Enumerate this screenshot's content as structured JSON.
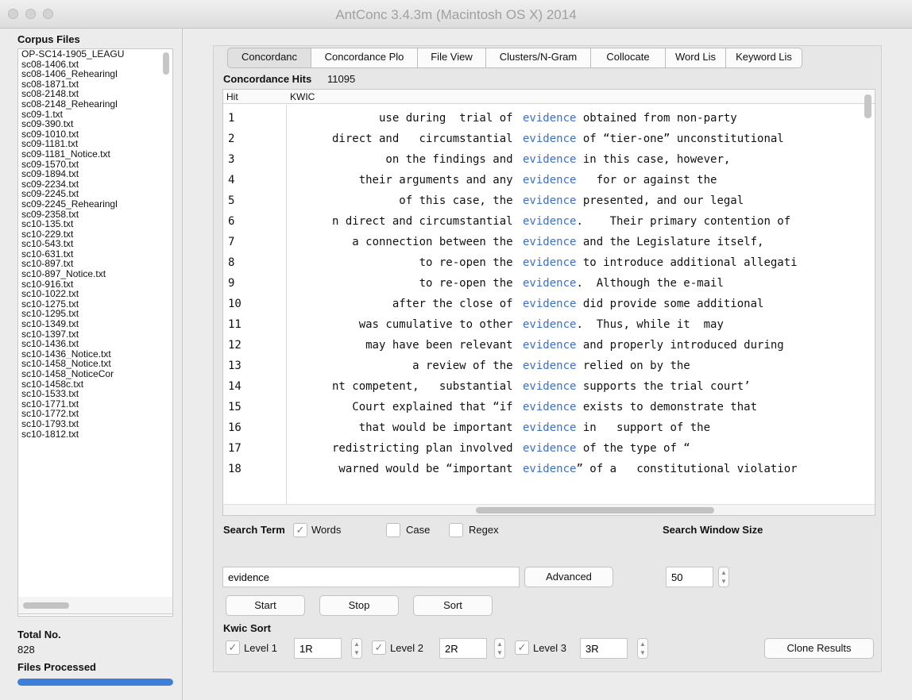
{
  "window": {
    "title": "AntConc 3.4.3m (Macintosh OS X) 2014"
  },
  "corpus": {
    "title": "Corpus Files",
    "files": [
      "OP-SC14-1905_LEAGU",
      "sc08-1406.txt",
      "sc08-1406_Rehearingl",
      "sc08-1871.txt",
      "sc08-2148.txt",
      "sc08-2148_Rehearingl",
      "sc09-1.txt",
      "sc09-390.txt",
      "sc09-1010.txt",
      "sc09-1181.txt",
      "sc09-1181_Notice.txt",
      "sc09-1570.txt",
      "sc09-1894.txt",
      "sc09-2234.txt",
      "sc09-2245.txt",
      "sc09-2245_Rehearingl",
      "sc09-2358.txt",
      "sc10-135.txt",
      "sc10-229.txt",
      "sc10-543.txt",
      "sc10-631.txt",
      "sc10-897.txt",
      "sc10-897_Notice.txt",
      "sc10-916.txt",
      "sc10-1022.txt",
      "sc10-1275.txt",
      "sc10-1295.txt",
      "sc10-1349.txt",
      "sc10-1397.txt",
      "sc10-1436.txt",
      "sc10-1436_Notice.txt",
      "sc10-1458_Notice.txt",
      "sc10-1458_NoticeCor",
      "sc10-1458c.txt",
      "sc10-1533.txt",
      "sc10-1771.txt",
      "sc10-1772.txt",
      "sc10-1793.txt",
      "sc10-1812.txt"
    ],
    "total_label": "Total No.",
    "total_value": "828",
    "processed_label": "Files Processed",
    "processed_fraction": 1.0
  },
  "tabs": [
    {
      "label": "Concordanc",
      "active": true
    },
    {
      "label": "Concordance Plo",
      "active": false
    },
    {
      "label": "File View",
      "active": false
    },
    {
      "label": "Clusters/N-Gram",
      "active": false
    },
    {
      "label": "Collocate",
      "active": false
    },
    {
      "label": "Word Lis",
      "active": false
    },
    {
      "label": "Keyword Lis",
      "active": false
    }
  ],
  "concordance": {
    "hits_label": "Concordance Hits",
    "hits_value": "11095",
    "col_hit": "Hit",
    "col_kwic": "KWIC",
    "keyword": "evidence",
    "rows": [
      {
        "n": "1",
        "left": "use during  trial of ",
        "after": " obtained from non-party"
      },
      {
        "n": "2",
        "left": "direct and   circumstantial ",
        "after": " of “tier-one” unconstitutional"
      },
      {
        "n": "3",
        "left": "on the findings and ",
        "after": " in this case, however,"
      },
      {
        "n": "4",
        "left": "their arguments and any ",
        "after": "   for or against the"
      },
      {
        "n": "5",
        "left": "of this case, the ",
        "after": " presented, and our legal"
      },
      {
        "n": "6",
        "left": "n direct and circumstantial ",
        "after": ".    Their primary contention of"
      },
      {
        "n": "7",
        "left": "a connection between the ",
        "after": " and the Legislature itself,"
      },
      {
        "n": "8",
        "left": "to re-open the ",
        "after": " to introduce additional allegati"
      },
      {
        "n": "9",
        "left": "to re-open the ",
        "after": ".  Although the e-mail"
      },
      {
        "n": "10",
        "left": "after the close of ",
        "after": " did provide some additional"
      },
      {
        "n": "11",
        "left": "was cumulative to other ",
        "after": ".  Thus, while it  may"
      },
      {
        "n": "12",
        "left": "may have been relevant ",
        "after": " and properly introduced during"
      },
      {
        "n": "13",
        "left": "a review of the ",
        "after": " relied on by the"
      },
      {
        "n": "14",
        "left": "nt competent,   substantial ",
        "after": " supports the trial court’"
      },
      {
        "n": "15",
        "left": "Court explained that “if ",
        "after": " exists to demonstrate that"
      },
      {
        "n": "16",
        "left": "that would be important ",
        "after": " in   support of the"
      },
      {
        "n": "17",
        "left": "redistricting plan involved ",
        "after": " of the type of “"
      },
      {
        "n": "18",
        "left": "warned would be “important ",
        "after": "” of a   constitutional violatior"
      }
    ]
  },
  "search": {
    "term_label": "Search Term",
    "words_label": "Words",
    "words_checked": true,
    "case_label": "Case",
    "case_checked": false,
    "regex_label": "Regex",
    "regex_checked": false,
    "value": "evidence",
    "advanced_label": "Advanced",
    "window_size_label": "Search Window Size",
    "window_size_value": "50",
    "start_label": "Start",
    "stop_label": "Stop",
    "sort_label": "Sort"
  },
  "kwic_sort": {
    "label": "Kwic Sort",
    "levels": [
      {
        "label": "Level 1",
        "value": "1R",
        "checked": true
      },
      {
        "label": "Level 2",
        "value": "2R",
        "checked": true
      },
      {
        "label": "Level 3",
        "value": "3R",
        "checked": true
      }
    ],
    "clone_label": "Clone Results"
  }
}
